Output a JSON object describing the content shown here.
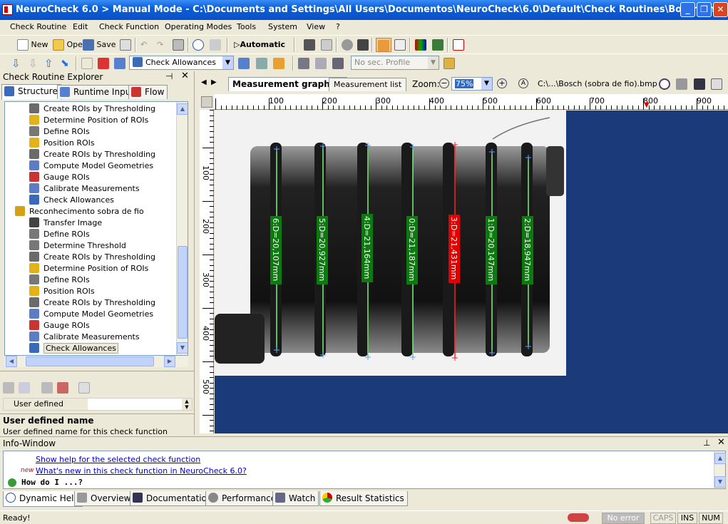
{
  "window": {
    "title": "NeuroCheck 6.0 > Manual Mode - C:\\Documents and Settings\\All Users\\Documentos\\NeuroCheck\\6.0\\Default\\Check Routines\\Bosch.chr"
  },
  "menu": [
    "Check Routine",
    "Edit",
    "Check Function",
    "Operating Modes",
    "Tools",
    "System",
    "View",
    "?"
  ],
  "toolbar1": {
    "new": "New",
    "open": "Open",
    "save": "Save",
    "automatic": "Automatic"
  },
  "toolbar2": {
    "function_combo": "Check Allowances",
    "profile_combo": "No sec. Profile"
  },
  "explorer": {
    "title": "Check Routine Explorer",
    "tabs": [
      "Structure",
      "Runtime Input",
      "Flow"
    ],
    "tree": [
      {
        "label": "Create ROIs by Thresholding",
        "icon": "thresholding-icon",
        "level": 2
      },
      {
        "label": "Determine Position of ROIs",
        "icon": "position-icon",
        "level": 2
      },
      {
        "label": "Define ROIs",
        "icon": "define-roi-icon",
        "level": 2
      },
      {
        "label": "Position ROIs",
        "icon": "position-roi-icon",
        "level": 2
      },
      {
        "label": "Create ROIs by Thresholding",
        "icon": "thresholding-icon",
        "level": 2
      },
      {
        "label": "Compute Model Geometries",
        "icon": "geometry-icon",
        "level": 2
      },
      {
        "label": "Gauge ROIs",
        "icon": "gauge-icon",
        "level": 2
      },
      {
        "label": "Calibrate Measurements",
        "icon": "calibrate-icon",
        "level": 2
      },
      {
        "label": "Check Allowances",
        "icon": "allowance-icon",
        "level": 2
      },
      {
        "label": "Reconhecimento sobra de fio",
        "icon": "check-folder-icon",
        "level": 1
      },
      {
        "label": "Transfer Image",
        "icon": "transfer-icon",
        "level": 2
      },
      {
        "label": "Define ROIs",
        "icon": "define-roi-icon",
        "level": 2
      },
      {
        "label": "Determine Threshold",
        "icon": "threshold-icon",
        "level": 2
      },
      {
        "label": "Create ROIs by Thresholding",
        "icon": "thresholding-icon",
        "level": 2
      },
      {
        "label": "Determine Position of ROIs",
        "icon": "position-icon",
        "level": 2
      },
      {
        "label": "Define ROIs",
        "icon": "define-roi-icon",
        "level": 2
      },
      {
        "label": "Position ROIs",
        "icon": "position-roi-icon",
        "level": 2
      },
      {
        "label": "Create ROIs by Thresholding",
        "icon": "thresholding-icon",
        "level": 2
      },
      {
        "label": "Compute Model Geometries",
        "icon": "geometry-icon",
        "level": 2
      },
      {
        "label": "Gauge ROIs",
        "icon": "gauge-icon",
        "level": 2
      },
      {
        "label": "Calibrate Measurements",
        "icon": "calibrate-icon",
        "level": 2
      },
      {
        "label": "Check Allowances",
        "icon": "allowance-icon",
        "level": 2,
        "selected": true
      }
    ]
  },
  "properties": {
    "row_label": "User defined name",
    "desc_title": "User defined name",
    "desc_text": "User defined name for this check function"
  },
  "viewer": {
    "tabs": [
      "Measurement graphics",
      "Measurement list"
    ],
    "zoom_label": "Zoom:",
    "zoom_value": "75%",
    "image_path": "C:\\...\\Bosch (sobra de fio).bmp",
    "ruler_top": [
      "100",
      "200",
      "300",
      "400",
      "500",
      "600",
      "700",
      "800",
      "900"
    ],
    "ruler_left": [
      "100",
      "200",
      "300",
      "400",
      "500"
    ],
    "measurements": [
      {
        "label": "6:D=20,107mm",
        "status": "ok"
      },
      {
        "label": "5:D=20,927mm",
        "status": "ok"
      },
      {
        "label": "4:D=21,164mm",
        "status": "ok"
      },
      {
        "label": "0:D=21,187mm",
        "status": "ok"
      },
      {
        "label": "3:D=21,431mm",
        "status": "fail"
      },
      {
        "label": "1:D=20,147mm",
        "status": "ok"
      },
      {
        "label": "2:D=18,947mm",
        "status": "ok"
      }
    ]
  },
  "info": {
    "title": "Info-Window",
    "link1": "Show help for the selected check function",
    "new_badge": "new",
    "link2": "What's new in this check function in NeuroCheck 6.0?",
    "howdo": "How do I ...?"
  },
  "bottom_tabs": [
    "Dynamic Help",
    "Overview",
    "Documentation",
    "Performance",
    "Watch",
    "Result Statistics"
  ],
  "status": {
    "ready": "Ready!",
    "error": "No error",
    "caps": "CAPS",
    "ins": "INS",
    "num": "NUM"
  },
  "colors": {
    "ok": "#0d7a10",
    "fail": "#e00000",
    "bg_canvas": "#1b3a7a"
  }
}
